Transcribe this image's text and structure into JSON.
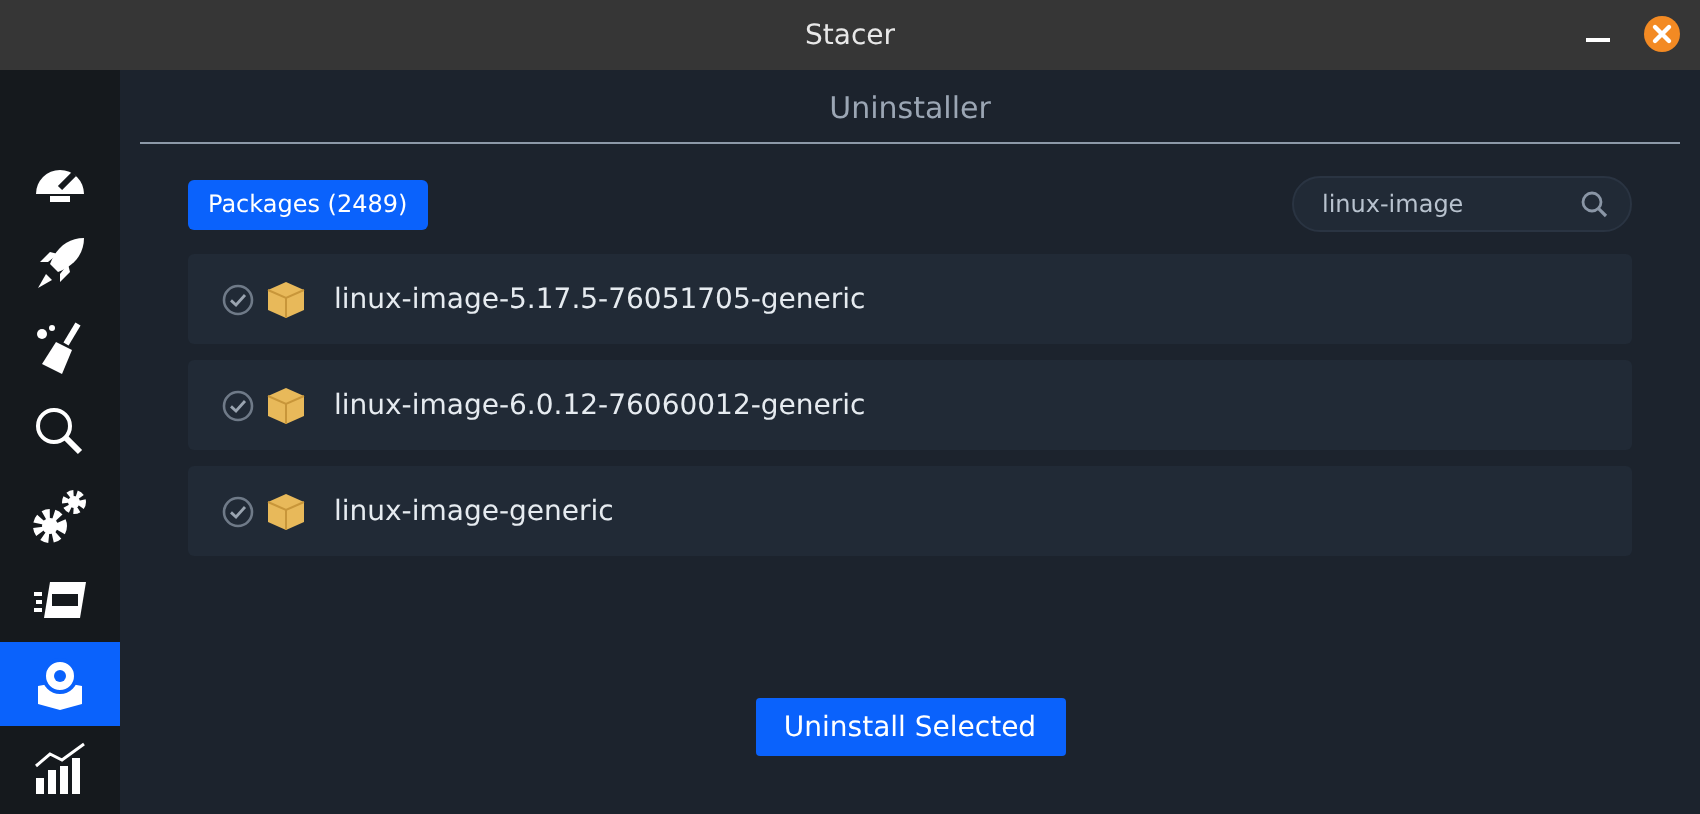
{
  "window": {
    "title": "Stacer"
  },
  "sidebar": {
    "items": [
      {
        "kind": "dashboard",
        "selected": false
      },
      {
        "kind": "startup",
        "selected": false
      },
      {
        "kind": "cleaner",
        "selected": false
      },
      {
        "kind": "search",
        "selected": false
      },
      {
        "kind": "services",
        "selected": false
      },
      {
        "kind": "processes",
        "selected": false
      },
      {
        "kind": "uninstaller",
        "selected": true
      },
      {
        "kind": "resources",
        "selected": false
      }
    ]
  },
  "page": {
    "title": "Uninstaller"
  },
  "packages_tab": "Packages (2489)",
  "search": {
    "value": "linux-image"
  },
  "packages": [
    {
      "name": "linux-image-5.17.5-76051705-generic",
      "checked": true
    },
    {
      "name": "linux-image-6.0.12-76060012-generic",
      "checked": true
    },
    {
      "name": "linux-image-generic",
      "checked": true
    }
  ],
  "action_button": "Uninstall Selected"
}
